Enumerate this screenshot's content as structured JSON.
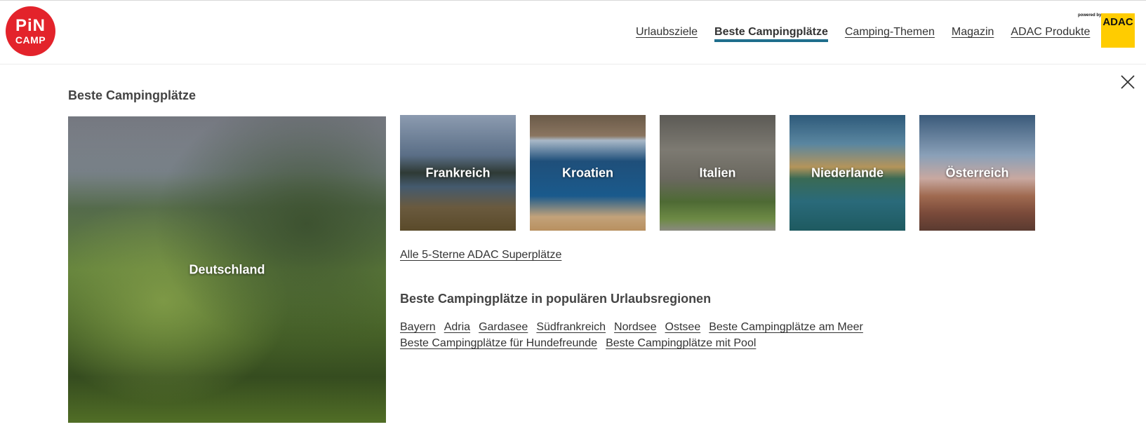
{
  "logo": {
    "line1": "PiN",
    "line2": "CAMP"
  },
  "nav": [
    {
      "label": "Urlaubsziele",
      "active": false
    },
    {
      "label": "Beste Campingplätze",
      "active": true
    },
    {
      "label": "Camping-Themen",
      "active": false
    },
    {
      "label": "Magazin",
      "active": false
    },
    {
      "label": "ADAC Produkte",
      "active": false
    }
  ],
  "adac": {
    "powered_by": "powered by",
    "logo_text": "ADAC"
  },
  "colors": {
    "brand_red": "#e3232b",
    "nav_active_underline": "#1f6e8c",
    "adac_yellow": "#ffcc00"
  },
  "panel": {
    "title": "Beste Campingplätze",
    "featured": {
      "label": "Deutschland"
    },
    "countries": [
      {
        "label": "Frankreich"
      },
      {
        "label": "Kroatien"
      },
      {
        "label": "Italien"
      },
      {
        "label": "Niederlande"
      },
      {
        "label": "Österreich"
      }
    ],
    "superplaetze_link": "Alle 5-Sterne ADAC Superplätze",
    "regions_title": "Beste Campingplätze in populären Urlaubsregionen",
    "regions": [
      "Bayern",
      "Adria",
      "Gardasee",
      "Südfrankreich",
      "Nordsee",
      "Ostsee",
      "Beste Campingplätze am Meer",
      "Beste Campingplätze für Hundefreunde",
      "Beste Campingplätze mit Pool"
    ]
  }
}
